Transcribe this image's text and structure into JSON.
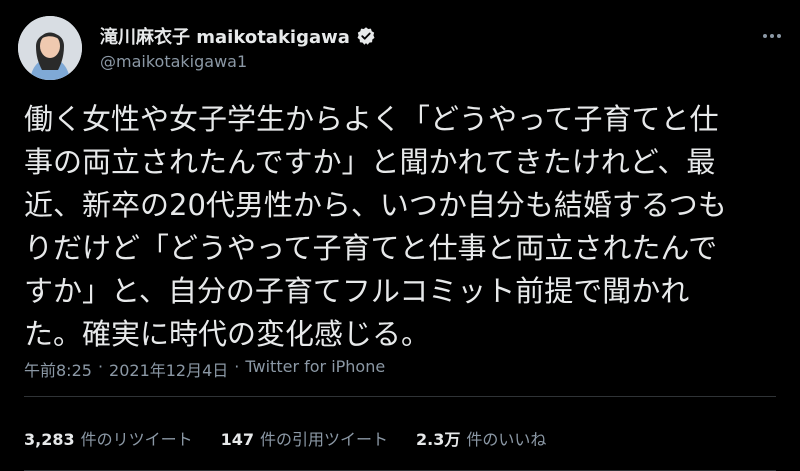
{
  "author": {
    "display_name": "滝川麻衣子 maikotakigawa",
    "handle": "@maikotakigawa1",
    "verified_icon": "verified-badge-icon"
  },
  "tweet": {
    "text": "働く女性や女子学生からよく「どうやって子育てと仕\n事の両立されたんですか」と聞かれてきたけれど、最\n近、新卒の20代男性から、いつか自分も結婚するつも\nりだけど「どうやって子育てと仕事と両立されたんで\nすか」と、自分の子育てフルコミット前提で聞かれ\nた。確実に時代の変化感じる。",
    "time": "午前8:25",
    "separator": "·",
    "date": "2021年12月4日",
    "source": "Twitter for iPhone"
  },
  "stats": {
    "retweets_count": "3,283",
    "retweets_label": "件のリツイート",
    "quotes_count": "147",
    "quotes_label": "件の引用ツイート",
    "likes_count": "2.3万",
    "likes_label": "件のいいね"
  },
  "colors": {
    "background": "#000000",
    "text": "#e7e9ea",
    "secondary_text": "#8b98a5",
    "divider": "#2f3336"
  }
}
